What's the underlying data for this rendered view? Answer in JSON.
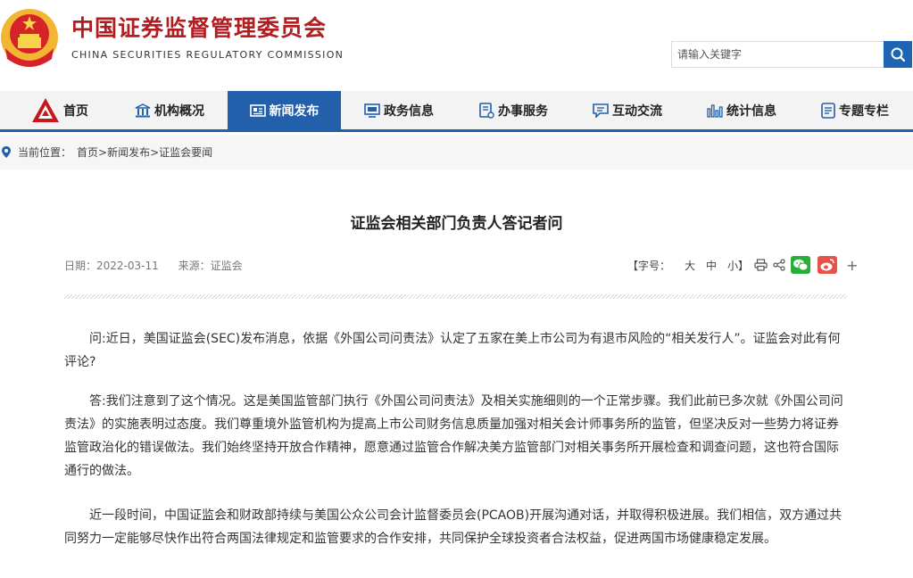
{
  "header": {
    "title_cn": "中国证券监督管理委员会",
    "title_en": "CHINA SECURITIES REGULATORY COMMISSION",
    "search_placeholder": "请输入关键字"
  },
  "nav": {
    "items": [
      {
        "label": "首页",
        "icon": "home-logo-icon"
      },
      {
        "label": "机构概况",
        "icon": "institution-icon"
      },
      {
        "label": "新闻发布",
        "icon": "news-icon",
        "active": true
      },
      {
        "label": "政务信息",
        "icon": "monitor-icon"
      },
      {
        "label": "办事服务",
        "icon": "service-icon"
      },
      {
        "label": "互动交流",
        "icon": "chat-icon"
      },
      {
        "label": "统计信息",
        "icon": "bar-chart-icon"
      },
      {
        "label": "专题专栏",
        "icon": "document-icon"
      }
    ],
    "active_color": "#2360ac"
  },
  "breadcrumb": {
    "prefix": "当前位置：",
    "items": [
      "首页",
      "新闻发布",
      "证监会要闻"
    ],
    "separator": ">"
  },
  "article": {
    "title": "证监会相关部门负责人答记者问",
    "date": "日期：2022-03-11",
    "source": "来源：证监会",
    "font_size_label": "【字号：",
    "size_large": "大",
    "size_medium": "中",
    "size_small": "小】",
    "paragraphs": [
      "问:近日，美国证监会(SEC)发布消息，依据《外国公司问责法》认定了五家在美上市公司为有退市风险的“相关发行人”。证监会对此有何评论?",
      "答:我们注意到了这个情况。这是美国监管部门执行《外国公司问责法》及相关实施细则的一个正常步骤。我们此前已多次就《外国公司问责法》的实施表明过态度。我们尊重境外监管机构为提高上市公司财务信息质量加强对相关会计师事务所的监管，但坚决反对一些势力将证券监管政治化的错误做法。我们始终坚持开放合作精神，愿意通过监管合作解决美方监管部门对相关事务所开展检查和调查问题，这也符合国际通行的做法。",
      "近一段时间，中国证监会和财政部持续与美国公众公司会计监督委员会(PCAOB)开展沟通对话，并取得积极进展。我们相信，双方通过共同努力一定能够尽快作出符合两国法律规定和监管要求的合作安排，共同保护全球投资者合法权益，促进两国市场健康稳定发展。"
    ],
    "share": {
      "more_label": "+"
    }
  },
  "colors": {
    "brand_red": "#b01e22",
    "nav_blue": "#2360ac",
    "wechat_green": "#2aae3a",
    "weibo_red": "#e6534a"
  }
}
